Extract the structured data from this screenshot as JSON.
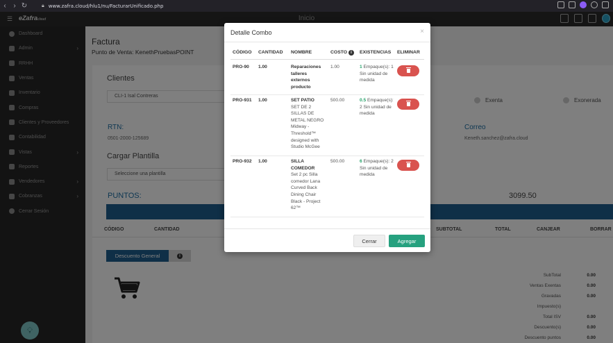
{
  "browser": {
    "url": "www.zafra.cloud/hlu1/nu/FacturarUnificado.php"
  },
  "app": {
    "title": "Inicio",
    "logo": "eZafra",
    "logo_suffix": "cloud"
  },
  "sidebar": {
    "items": [
      {
        "label": "Dashboard",
        "icon": "dashboard-icon",
        "chevron": false
      },
      {
        "label": "Admin",
        "icon": "wrench-icon",
        "chevron": true
      },
      {
        "label": "RRHH",
        "icon": "people-icon",
        "chevron": false
      },
      {
        "label": "Ventas",
        "icon": "money-icon",
        "chevron": false
      },
      {
        "label": "Inventario",
        "icon": "inventory-icon",
        "chevron": false
      },
      {
        "label": "Compras",
        "icon": "cart-icon",
        "chevron": false
      },
      {
        "label": "Clientes y Proveedores",
        "icon": "contacts-icon",
        "chevron": false
      },
      {
        "label": "Contabilidad",
        "icon": "accounting-icon",
        "chevron": false
      },
      {
        "label": "Vistas",
        "icon": "edit-icon",
        "chevron": true
      },
      {
        "label": "Reportes",
        "icon": "reports-icon",
        "chevron": false
      },
      {
        "label": "Vendedores",
        "icon": "person-icon",
        "chevron": true
      },
      {
        "label": "Cobranzas",
        "icon": "edit-icon",
        "chevron": true
      },
      {
        "label": "Cerrar Sesión",
        "icon": "power-icon",
        "chevron": false
      }
    ]
  },
  "page": {
    "title": "Factura",
    "subtitle": "Punto de Venta: KenethPruebasPOINT",
    "clientes_label": "Clientes",
    "cliente_value": "CLI-1   Isal Contreras",
    "radio_exenta": "Exenta",
    "radio_exonerada": "Exonerada",
    "rtn_label": "RTN:",
    "rtn_value": "0501-2000-125689",
    "correo_label": "Correo",
    "correo_value": "Keneth.sanchez@zafra.cloud",
    "cargar_label": "Cargar Plantilla",
    "plantilla_placeholder": "Seleccione una plantilla",
    "puntos_label": "PUNTOS:",
    "puntos_value": "3099.50",
    "columns": {
      "codigo": "CÓDIGO",
      "cantidad": "CANTIDAD",
      "subtotal": "SUBTOTAL",
      "total": "TOTAL",
      "canjear": "CANJEAR",
      "borrar": "BORRAR"
    },
    "descuento_button": "Descuento General",
    "summary": [
      {
        "label": "SubTotal",
        "value": "0.00"
      },
      {
        "label": "Ventas Exentas",
        "value": "0.00"
      },
      {
        "label": "Gravadas",
        "value": "0.00"
      },
      {
        "label": "Impuesto(s)",
        "value": ""
      },
      {
        "label": "Total ISV",
        "value": "0.00"
      },
      {
        "label": "Descuento(s)",
        "value": "0.00"
      },
      {
        "label": "Descuento puntos",
        "value": "0.00"
      }
    ]
  },
  "modal": {
    "title": "Detalle Combo",
    "close_symbol": "×",
    "headers": {
      "codigo": "CÓDIGO",
      "cantidad": "CANTIDAD",
      "nombre": "NOMBRE",
      "costo": "COSTO",
      "existencias": "EXISTENCIAS",
      "eliminar": "ELIMINAR"
    },
    "rows": [
      {
        "codigo": "PRO-90",
        "cantidad": "1.00",
        "nombre_bold": "Reparaciones talleres externos producto",
        "nombre_desc": "",
        "costo": "1.00",
        "stock_num": "1",
        "stock_text": "Empaque(s): 1 Sin unidad de medida"
      },
      {
        "codigo": "PRO-931",
        "cantidad": "1.00",
        "nombre_bold": "SET PATIO",
        "nombre_desc": "SET DE 2 SILLAS DE METAL NEGRO Midway - Threshold™ designed with Studio McGee",
        "costo": "500.00",
        "stock_num": "0.5",
        "stock_text": "Empaque(s): 2 Sin unidad de medida"
      },
      {
        "codigo": "PRO-932",
        "cantidad": "1.00",
        "nombre_bold": "SILLA COMEDOR",
        "nombre_desc": "Set 2 pc Silla comedor Lana Curved Back Dining Chair Black - Project 62™",
        "costo": "500.00",
        "stock_num": "6",
        "stock_text": "Empaque(s): 2 Sin unidad de medida"
      }
    ],
    "cerrar_button": "Cerrar",
    "agregar_button": "Agregar"
  }
}
